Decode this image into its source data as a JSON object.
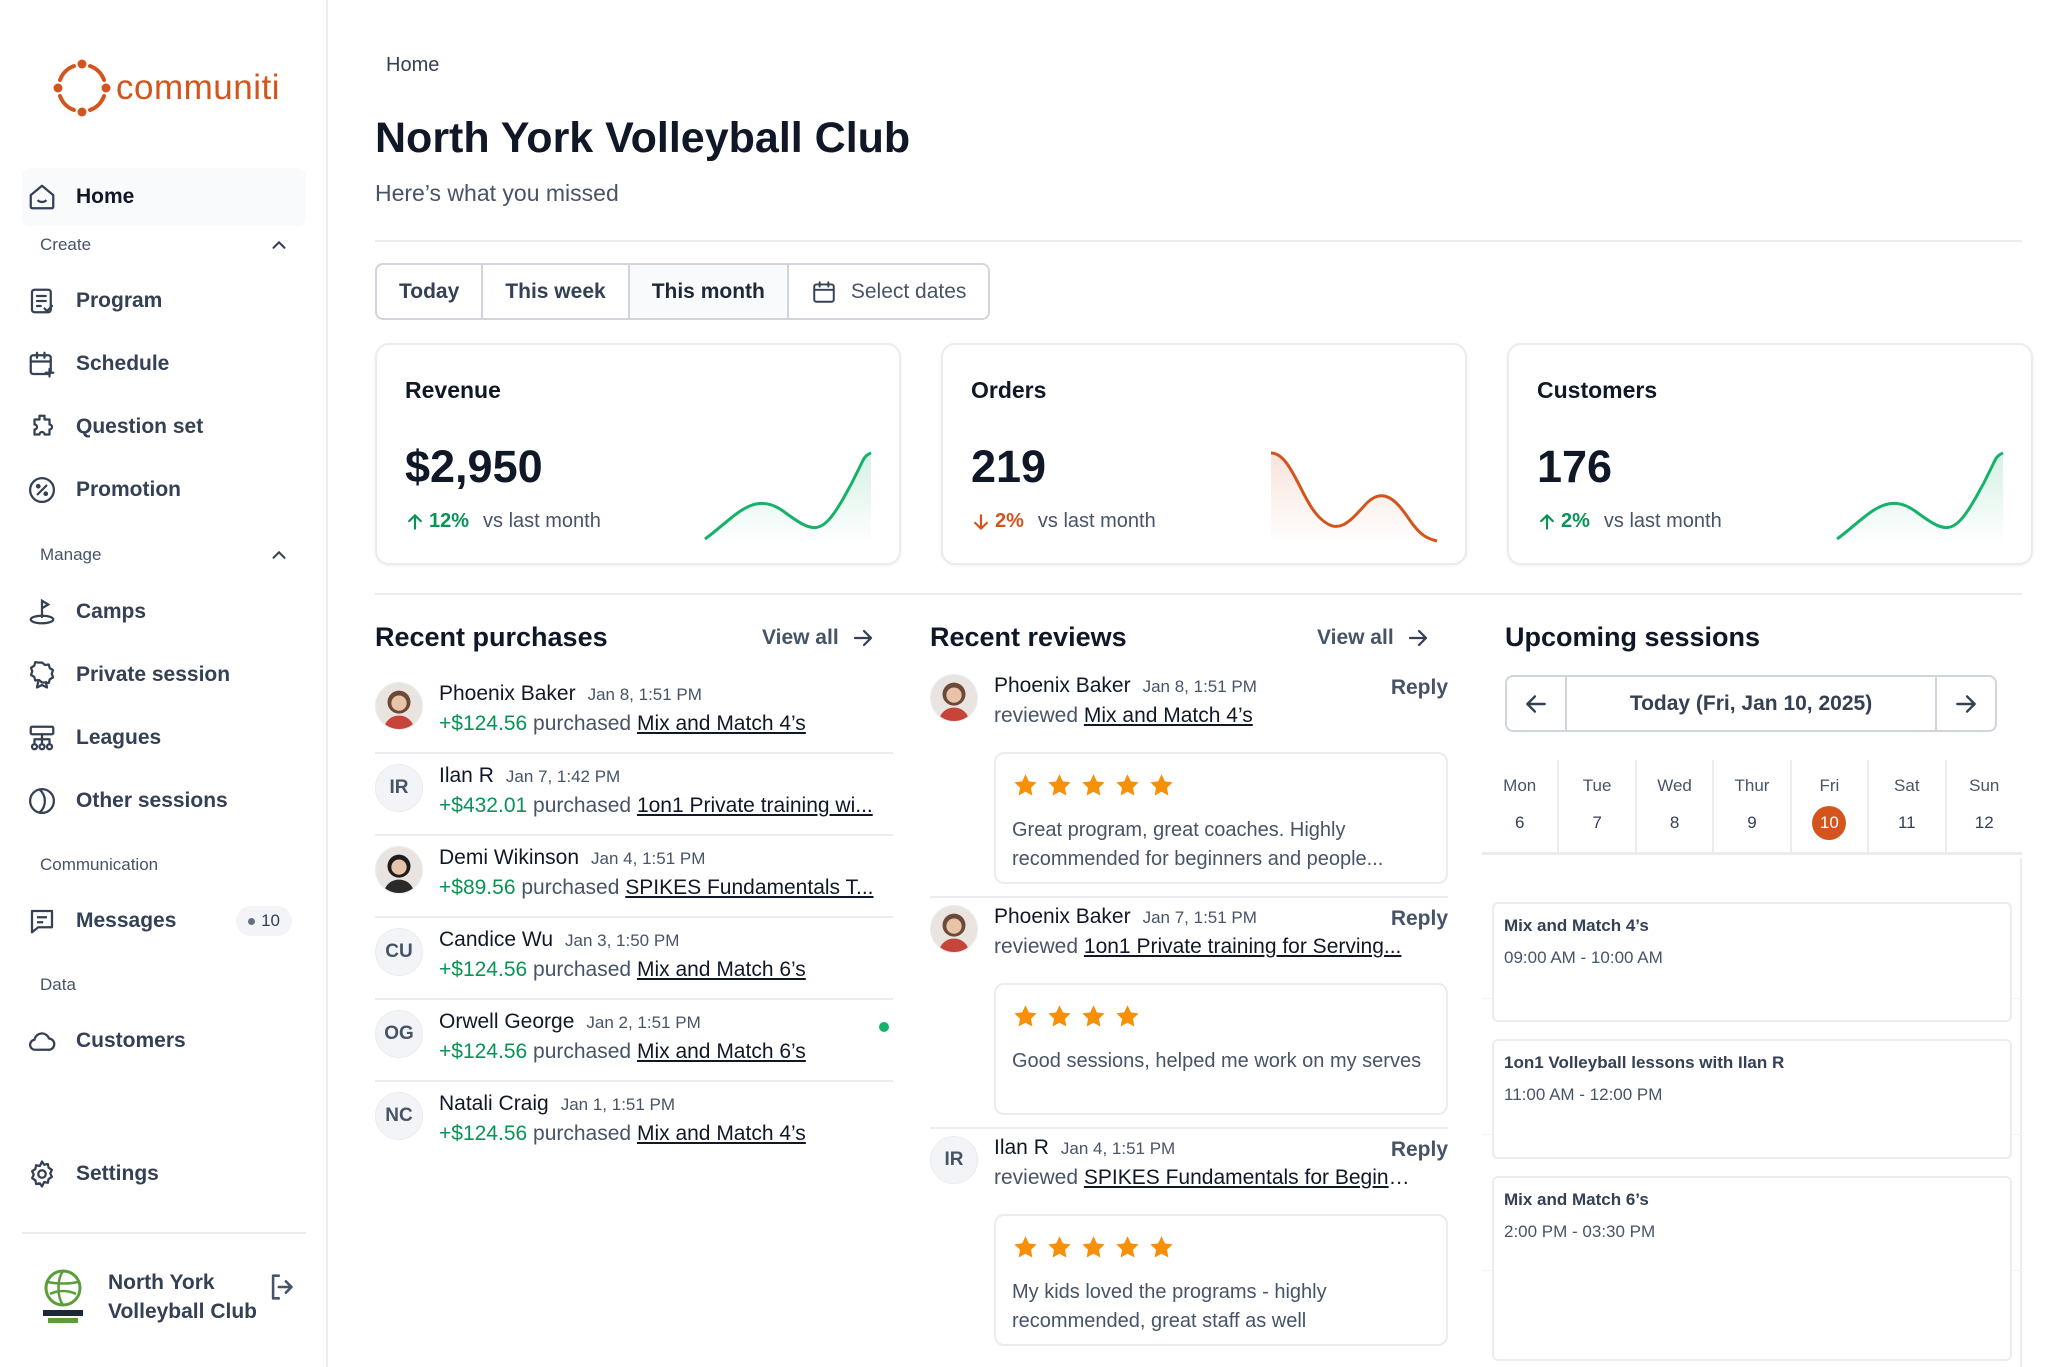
{
  "brand": {
    "name": "communiti",
    "color": "#D4541D"
  },
  "sidebar": {
    "home": "Home",
    "sections": {
      "create": "Create",
      "manage": "Manage",
      "communication": "Communication",
      "data": "Data"
    },
    "create_items": [
      "Program",
      "Schedule",
      "Question set",
      "Promotion"
    ],
    "manage_items": [
      "Camps",
      "Private session",
      "Leagues",
      "Other sessions"
    ],
    "messages": {
      "label": "Messages",
      "count": "10"
    },
    "customers": "Customers",
    "settings": "Settings",
    "club": "North York Volleyball Club"
  },
  "header": {
    "breadcrumb": "Home",
    "title": "North York Volleyball Club",
    "subtitle": "Here’s what you missed"
  },
  "filters": {
    "today": "Today",
    "this_week": "This week",
    "this_month": "This month",
    "select_dates": "Select dates",
    "selected": "This month"
  },
  "metrics": [
    {
      "title": "Revenue",
      "value": "$2,950",
      "change": "12%",
      "direction": "up",
      "comparison": "vs last month"
    },
    {
      "title": "Orders",
      "value": "219",
      "change": "2%",
      "direction": "down",
      "comparison": "vs last month"
    },
    {
      "title": "Customers",
      "value": "176",
      "change": "2%",
      "direction": "up",
      "comparison": "vs last month"
    }
  ],
  "purchases": {
    "title": "Recent purchases",
    "view_all": "View all",
    "items": [
      {
        "initials": "",
        "photo": true,
        "name": "Phoenix Baker",
        "date": "Jan 8, 1:51 PM",
        "amount": "+$124.56",
        "verb": "purchased",
        "program": "Mix and Match 4’s",
        "online": false
      },
      {
        "initials": "IR",
        "photo": false,
        "name": "Ilan R",
        "date": "Jan 7, 1:42 PM",
        "amount": "+$432.01",
        "verb": "purchased",
        "program": "1on1 Private training wi...",
        "online": false
      },
      {
        "initials": "",
        "photo": true,
        "name": "Demi Wikinson",
        "date": "Jan 4, 1:51 PM",
        "amount": "+$89.56",
        "verb": "purchased",
        "program": "SPIKES Fundamentals T...",
        "online": false
      },
      {
        "initials": "CU",
        "photo": false,
        "name": "Candice Wu",
        "date": "Jan 3, 1:50 PM",
        "amount": "+$124.56",
        "verb": "purchased",
        "program": "Mix and Match 6’s",
        "online": false
      },
      {
        "initials": "OG",
        "photo": false,
        "name": "Orwell George",
        "date": "Jan 2, 1:51 PM",
        "amount": "+$124.56",
        "verb": "purchased",
        "program": "Mix and Match 6’s",
        "online": true
      },
      {
        "initials": "NC",
        "photo": false,
        "name": "Natali Craig",
        "date": "Jan 1, 1:51 PM",
        "amount": "+$124.56",
        "verb": "purchased",
        "program": "Mix and Match 4’s",
        "online": false
      }
    ]
  },
  "reviews": {
    "title": "Recent reviews",
    "view_all": "View all",
    "reply": "Reply",
    "items": [
      {
        "initials": "",
        "photo": true,
        "name": "Phoenix Baker",
        "date": "Jan 8, 1:51 PM",
        "verb": "reviewed",
        "program": "Mix and Match 4’s",
        "rating": 5,
        "text": "Great program, great coaches. Highly recommended for beginners and people..."
      },
      {
        "initials": "",
        "photo": true,
        "name": "Phoenix Baker",
        "date": "Jan 7, 1:51 PM",
        "verb": "reviewed",
        "program": "1on1 Private training for Serving...",
        "rating": 4,
        "text": "Good sessions, helped me work on my serves"
      },
      {
        "initials": "IR",
        "photo": false,
        "name": "Ilan R",
        "date": "Jan 4, 1:51 PM",
        "verb": "reviewed",
        "program": "SPIKES Fundamentals for Beginners",
        "rating": 5,
        "text": "My kids loved the programs - highly recommended, great staff as well"
      }
    ]
  },
  "sessions": {
    "title": "Upcoming sessions",
    "current_date": "Today (Fri, Jan 10, 2025)",
    "days": [
      {
        "name": "Mon",
        "num": "6"
      },
      {
        "name": "Tue",
        "num": "7"
      },
      {
        "name": "Wed",
        "num": "8"
      },
      {
        "name": "Thur",
        "num": "9"
      },
      {
        "name": "Fri",
        "num": "10"
      },
      {
        "name": "Sat",
        "num": "11"
      },
      {
        "name": "Sun",
        "num": "12"
      }
    ],
    "today_index": 4,
    "events": [
      {
        "title": "Mix and Match 4’s",
        "time": "09:00 AM - 10:00 AM"
      },
      {
        "title": "1on1 Volleyball lessons with Ilan R",
        "time": "11:00 AM - 12:00 PM"
      },
      {
        "title": "Mix and Match 6’s",
        "time": "2:00 PM - 03:30 PM"
      }
    ]
  },
  "colors": {
    "positive": "#079455",
    "negative": "#D4541D",
    "border": "#EAECF0",
    "text_secondary": "#475467"
  }
}
